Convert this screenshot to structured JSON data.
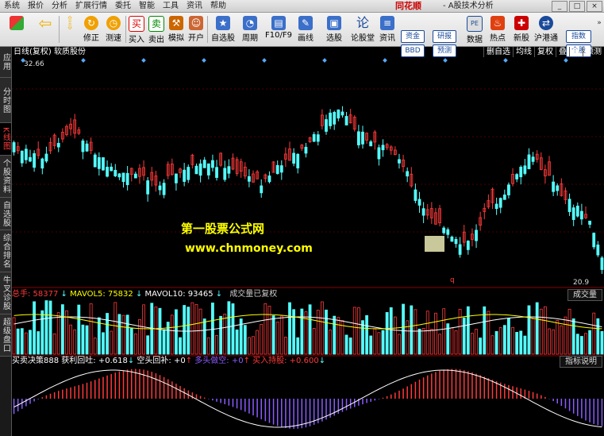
{
  "menubar": {
    "items": [
      "系统",
      "报价",
      "分析",
      "扩展行情",
      "委托",
      "智能",
      "工具",
      "资讯",
      "帮助"
    ],
    "brand": "同花顺",
    "window_title": "- A股技术分析"
  },
  "toolbar": {
    "buttons": [
      {
        "label": ""
      },
      {
        "label": ""
      },
      {
        "label": "修正"
      },
      {
        "label": "测速"
      },
      {
        "label": "买入"
      },
      {
        "label": "卖出"
      },
      {
        "label": "模拟"
      },
      {
        "label": "开户"
      },
      {
        "label": "自选股"
      },
      {
        "label": "周期"
      },
      {
        "label": "F10/F9"
      },
      {
        "label": "画线"
      },
      {
        "label": "选股"
      },
      {
        "label": "论股堂"
      },
      {
        "label": "资讯"
      },
      {
        "label": "数据"
      },
      {
        "label": "热点"
      },
      {
        "label": "新股"
      },
      {
        "label": "沪港通"
      }
    ],
    "mini_buttons": [
      "资金",
      "BBD",
      "研报",
      "预测",
      "指数",
      "个股"
    ]
  },
  "sidetabs": [
    "应用",
    "分时图",
    "K线图",
    "个股资料",
    "自选股",
    "综合排名",
    "牛叉诊股",
    "超级盘口"
  ],
  "chart_header": {
    "title": "日线(复权) 软质股份",
    "right_items": [
      "删自选",
      "均线",
      "复权",
      "叠",
      "窗",
      "预测"
    ]
  },
  "price_axis": {
    "top_label": "32.66",
    "bottom_label": "20.9"
  },
  "volume_header": {
    "total_label": "总手: 58377",
    "total_color": "#ff3a3a",
    "ma5_label": "MAVOL5: 75832",
    "ma5_color": "#ffff00",
    "ma10_label": "MAVOL10: 93465",
    "ma10_color": "#ffffff",
    "note": "成交量已复权",
    "panel": "成交量"
  },
  "indicator_header": {
    "name": "买卖决策888",
    "item1": "获利回吐: +0.618",
    "item2": "空头回补: +0",
    "item3": "多头做空: +0",
    "item3_color": "#8a5cff",
    "item4": "买入持股: +0.600",
    "item4_color": "#ff3a3a",
    "panel": "指标说明"
  },
  "watermark": {
    "line1": "第一股票公式网",
    "line2": "www.chnmoney.com"
  },
  "marker": "q",
  "colors": {
    "up": "#ff3a3a",
    "down": "#54ffff",
    "ma_white": "#ffffff",
    "ma_yellow": "#ffff00",
    "purple": "#8a5cff",
    "signal": "#0aa0ff"
  }
}
